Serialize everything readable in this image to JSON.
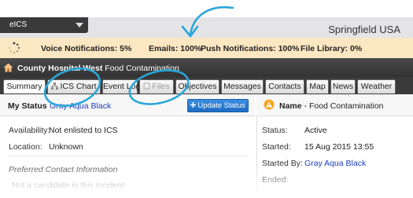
{
  "app": {
    "menu_label": "eICS",
    "org_name": "Springfield USA"
  },
  "notifications": [
    {
      "label": "Voice Notifications: 5%"
    },
    {
      "label": "Emails: 100%"
    },
    {
      "label": "Push Notifications: 100%"
    },
    {
      "label": "File Library: 0%"
    }
  ],
  "incident": {
    "hospital": "County Hospital West",
    "name": "Food Contamination"
  },
  "tabs": [
    {
      "label": "Summary"
    },
    {
      "label": "ICS Chart"
    },
    {
      "label": "Event Log"
    },
    {
      "label": "Files"
    },
    {
      "label": "Objectives"
    },
    {
      "label": "Messages"
    },
    {
      "label": "Contacts"
    },
    {
      "label": "Map"
    },
    {
      "label": "News"
    },
    {
      "label": "Weather"
    }
  ],
  "my_status": {
    "title": "My Status",
    "user": "Gray Aqua Black",
    "update_button": "Update Status",
    "availability_label": "Availability:",
    "availability_value": "Not enlisted to ICS",
    "location_label": "Location:",
    "location_value": "Unknown",
    "contact_section": "Preferred Contact Information",
    "contact_note": "Not a candidate in this incident"
  },
  "event_info": {
    "name_label": "Name",
    "name_value": "- Food Contamination",
    "status_label": "Status:",
    "status_value": "Active",
    "started_label": "Started:",
    "started_value": "15 Aug 2015 13:55",
    "started_by_label": "Started By:",
    "started_by_value": "Gray Aqua Black",
    "ended_label": "Ended:"
  },
  "colors": {
    "accent_blue": "#1f6dc4",
    "annotation": "#2aa6d9",
    "notification_bg": "#fbe7c1",
    "warning": "#f5a623"
  }
}
